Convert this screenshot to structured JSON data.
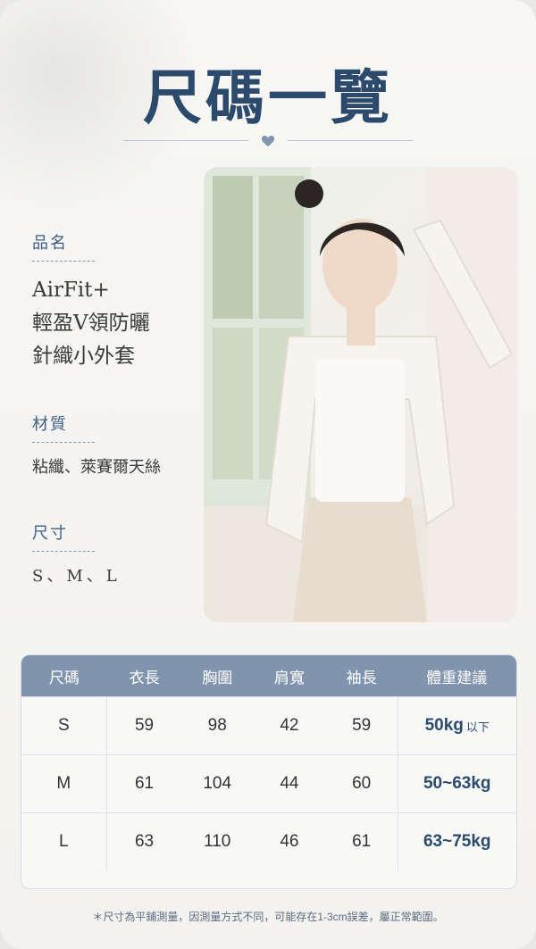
{
  "title": "尺碼一覽",
  "product": {
    "name_label": "品名",
    "name_line1": "AirFit+",
    "name_line2": "輕盈V領防曬",
    "name_line3": "針織小外套",
    "material_label": "材質",
    "material_value": "粘纖、萊賽爾天絲",
    "size_label": "尺寸",
    "size_value": "S、M、L"
  },
  "table": {
    "headers": [
      "尺碼",
      "衣長",
      "胸圍",
      "肩寬",
      "袖長",
      "體重建議"
    ],
    "rows": [
      {
        "size": "S",
        "length": "59",
        "chest": "98",
        "shoulder": "42",
        "sleeve": "59",
        "weight": "50kg",
        "weight_suffix": "以下"
      },
      {
        "size": "M",
        "length": "61",
        "chest": "104",
        "shoulder": "44",
        "sleeve": "60",
        "weight": "50~63kg",
        "weight_suffix": ""
      },
      {
        "size": "L",
        "length": "63",
        "chest": "110",
        "shoulder": "46",
        "sleeve": "61",
        "weight": "63~75kg",
        "weight_suffix": ""
      }
    ]
  },
  "note": "＊尺寸為平鋪測量，因測量方式不同，可能存在1-3cm誤差，屬正常範圍。",
  "colors": {
    "accent": "#2c4a6b",
    "table_header": "#8094ae",
    "label": "#3d5f86"
  },
  "photo": {
    "icon": "model-photo"
  }
}
